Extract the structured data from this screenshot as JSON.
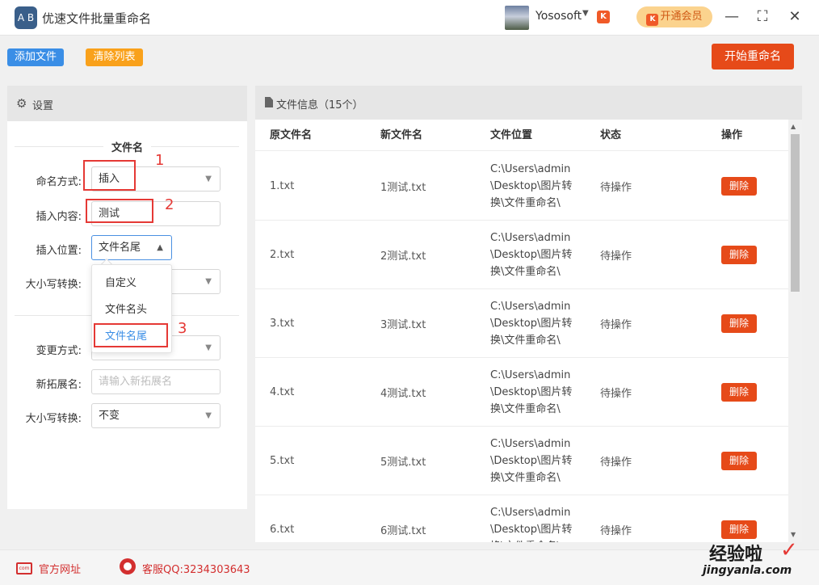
{
  "app": {
    "logo_text": "A B",
    "title": "优速文件批量重命名",
    "username": "Yososoft",
    "brand_badge": "K",
    "vip_label": "开通会员",
    "window_controls": {
      "minimize": "—",
      "maximize": "⛶",
      "close": "✕"
    }
  },
  "toolbar": {
    "add_label": "添加文件",
    "clear_label": "清除列表",
    "start_label": "开始重命名"
  },
  "settings": {
    "title": "设置",
    "section_filename": "文件名",
    "naming_mode_label": "命名方式:",
    "naming_mode_value": "插入",
    "insert_content_label": "插入内容:",
    "insert_content_value": "测试",
    "insert_position_label": "插入位置:",
    "insert_position_value": "文件名尾",
    "case_label": "大小写转换:",
    "change_mode_label": "变更方式:",
    "new_ext_label": "新拓展名:",
    "new_ext_placeholder": "请输入新拓展名",
    "ext_case_label": "大小写转换:",
    "ext_case_value": "不变",
    "position_options": [
      "自定义",
      "文件名头",
      "文件名尾"
    ],
    "position_selected": "文件名尾",
    "annotations": [
      "1",
      "2",
      "3"
    ]
  },
  "files": {
    "title": "文件信息（15个）",
    "columns": [
      "原文件名",
      "新文件名",
      "文件位置",
      "状态",
      "操作"
    ],
    "rows": [
      {
        "original": "1.txt",
        "new": "1测试.txt",
        "path": "C:\\Users\\admin\\Desktop\\图片转换\\文件重命名\\",
        "status": "待操作",
        "action": "删除"
      },
      {
        "original": "2.txt",
        "new": "2测试.txt",
        "path": "C:\\Users\\admin\\Desktop\\图片转换\\文件重命名\\",
        "status": "待操作",
        "action": "删除"
      },
      {
        "original": "3.txt",
        "new": "3测试.txt",
        "path": "C:\\Users\\admin\\Desktop\\图片转换\\文件重命名\\",
        "status": "待操作",
        "action": "删除"
      },
      {
        "original": "4.txt",
        "new": "4测试.txt",
        "path": "C:\\Users\\admin\\Desktop\\图片转换\\文件重命名\\",
        "status": "待操作",
        "action": "删除"
      },
      {
        "original": "5.txt",
        "new": "5测试.txt",
        "path": "C:\\Users\\admin\\Desktop\\图片转换\\文件重命名\\",
        "status": "待操作",
        "action": "删除"
      },
      {
        "original": "6.txt",
        "new": "6测试.txt",
        "path": "C:\\Users\\admin\\Desktop\\图片转换\\文件重命名\\",
        "status": "待操作",
        "action": "删除"
      }
    ]
  },
  "footer": {
    "website_label": "官方网址",
    "support_label": "客服QQ:3234303643"
  },
  "watermark": {
    "title": "经验啦",
    "check": "✓",
    "url": "jingyanla.com"
  },
  "colors": {
    "accent_blue": "#3a8ee6",
    "accent_orange": "#f9a11b",
    "accent_red": "#e64a19",
    "annotation_red": "#e53935"
  }
}
